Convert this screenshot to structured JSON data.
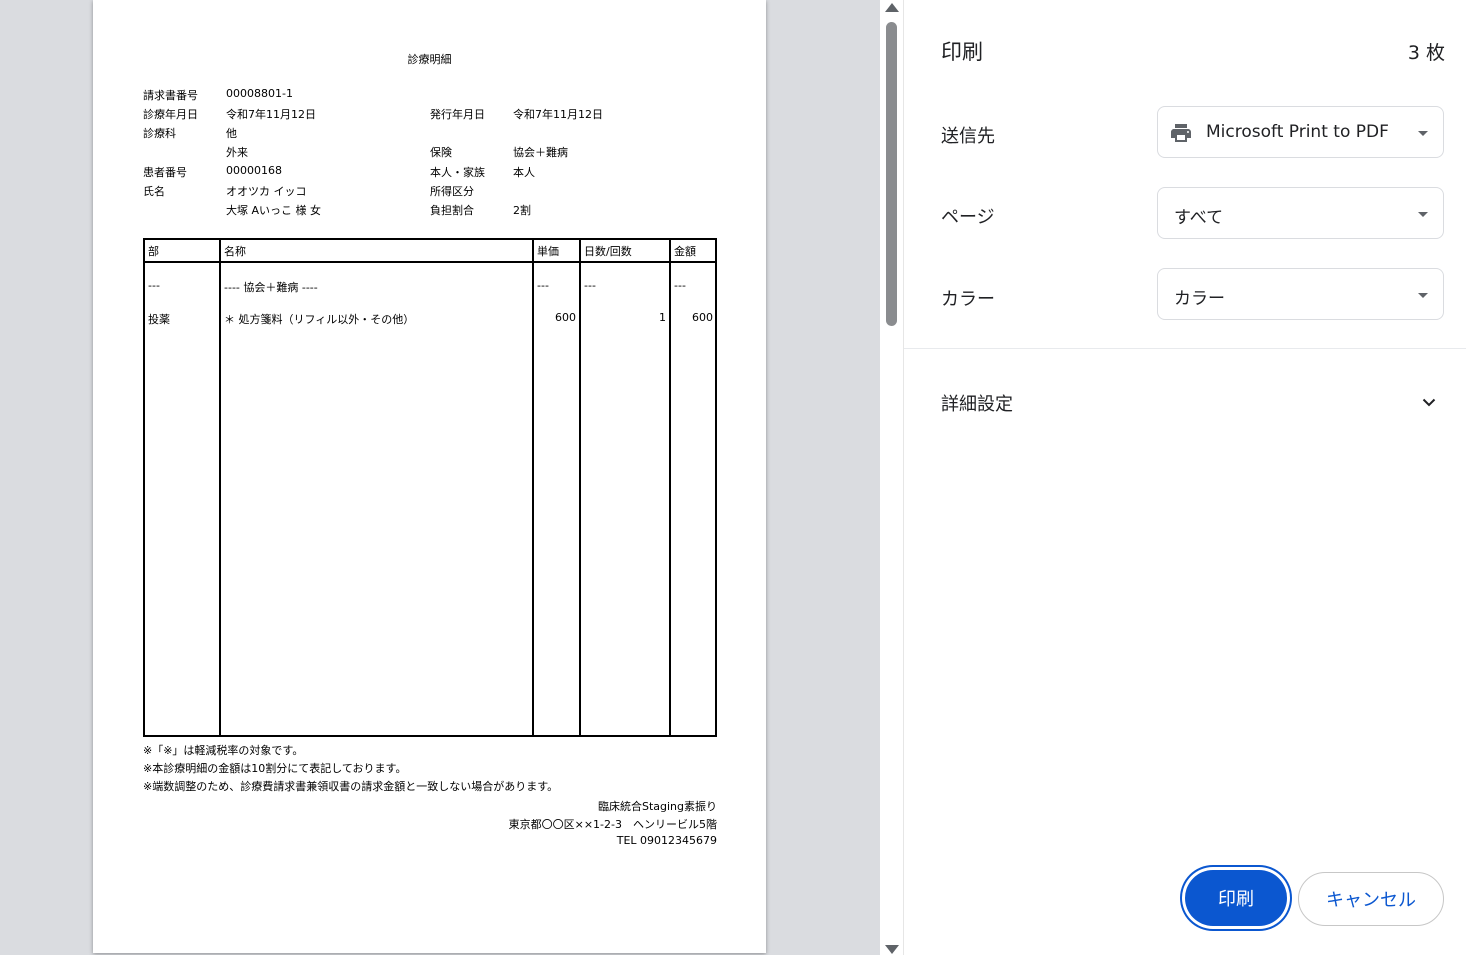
{
  "document": {
    "title": "診療明細",
    "header": {
      "invoice_no_label": "請求書番号",
      "invoice_no": "00008801-1",
      "visit_date_label": "診療年月日",
      "visit_date": "令和7年11月12日",
      "issue_date_label": "発行年月日",
      "issue_date": "令和7年11月12日",
      "department_label": "診療科",
      "department": "他",
      "visit_type": "外来",
      "insurance_label": "保険",
      "insurance": "協会＋難病",
      "patient_no_label": "患者番号",
      "patient_no": "00000168",
      "relation_label": "本人・家族",
      "relation": "本人",
      "name_label": "氏名",
      "name_kana": "オオツカ イッコ",
      "income_label": "所得区分",
      "name_kanji": "大塚 Aいっこ 様 女",
      "copay_label": "負担割合",
      "copay": "2割"
    },
    "table": {
      "columns": [
        "部",
        "名称",
        "単価",
        "日数/回数",
        "金額"
      ],
      "rows": [
        {
          "section": "---",
          "name": "---- 協会＋難病 ----",
          "unit": "---",
          "count": "---",
          "amount": "---"
        },
        {
          "section": "投薬",
          "name": "＊ 処方箋料（リフィル以外・その他）",
          "unit": "600",
          "count": "1",
          "amount": "600"
        }
      ]
    },
    "notes": [
      "※「※」は軽減税率の対象です。",
      "※本診療明細の金額は10割分にて表記しております。",
      "※端数調整のため、診療費請求書兼領収書の請求金額と一致しない場合があります。"
    ],
    "clinic": {
      "name": "臨床統合Staging素振り",
      "address": "東京都〇〇区××1-2-3　ヘンリービル5階",
      "tel": "TEL 09012345679"
    }
  },
  "panel": {
    "title": "印刷",
    "sheet_count": "3 枚",
    "destination_label": "送信先",
    "destination_value": "Microsoft Print to PDF",
    "pages_label": "ページ",
    "pages_value": "すべて",
    "color_label": "カラー",
    "color_value": "カラー",
    "more_settings_label": "詳細設定",
    "print_button": "印刷",
    "cancel_button": "キャンセル"
  },
  "colors": {
    "accent": "#0b57d0",
    "preview_bg": "#dadce0"
  },
  "icons": [
    "printer-icon",
    "chevron-down-icon",
    "scroll-up-arrow-icon",
    "scroll-down-arrow-icon"
  ]
}
